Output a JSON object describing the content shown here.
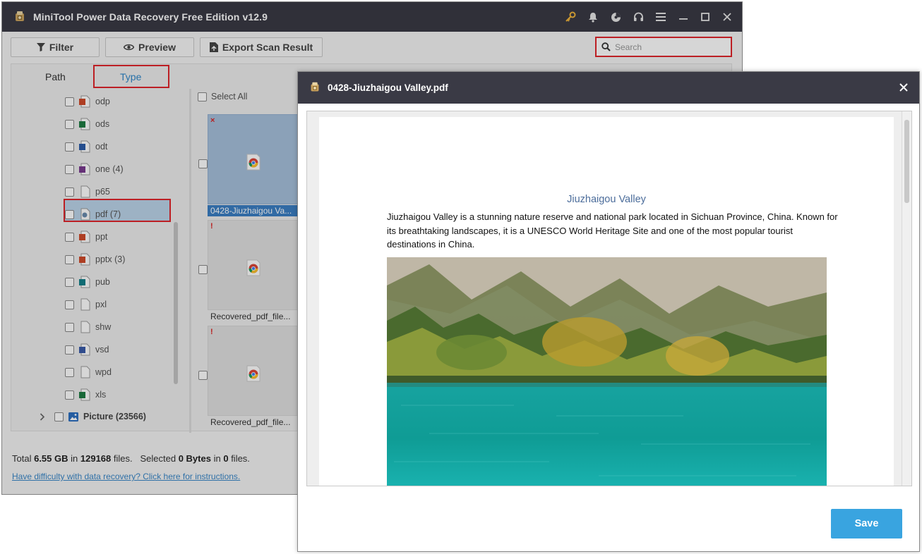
{
  "app": {
    "title": "MiniTool Power Data Recovery Free Edition v12.9",
    "window_icons": [
      "key-icon",
      "bell-icon",
      "disc-icon",
      "headset-icon",
      "menu-icon",
      "minimize-icon",
      "maximize-icon",
      "close-icon"
    ]
  },
  "toolbar": {
    "filter_label": "Filter",
    "preview_label": "Preview",
    "export_label": "Export Scan Result",
    "search_placeholder": "Search"
  },
  "tabs": {
    "path": "Path",
    "type": "Type"
  },
  "tree": {
    "items": [
      {
        "label": "odp",
        "icon": "presentation-icon",
        "color": "#d04a2a"
      },
      {
        "label": "ods",
        "icon": "spreadsheet-icon",
        "color": "#1e7c43"
      },
      {
        "label": "odt",
        "icon": "word-doc-icon",
        "color": "#2b5ca8"
      },
      {
        "label": "one (4)",
        "icon": "onenote-icon",
        "color": "#7a3b8f"
      },
      {
        "label": "p65",
        "icon": "blank-file-icon",
        "color": "#999999"
      },
      {
        "label": "pdf (7)",
        "icon": "pdf-file-icon",
        "color": "#6a8cae"
      },
      {
        "label": "ppt",
        "icon": "presentation-icon",
        "color": "#d04a2a"
      },
      {
        "label": "pptx (3)",
        "icon": "presentation-icon",
        "color": "#d04a2a"
      },
      {
        "label": "pub",
        "icon": "publisher-icon",
        "color": "#13808a"
      },
      {
        "label": "pxl",
        "icon": "blank-file-icon",
        "color": "#999999"
      },
      {
        "label": "shw",
        "icon": "blank-file-icon",
        "color": "#999999"
      },
      {
        "label": "vsd",
        "icon": "visio-icon",
        "color": "#3a5ba8"
      },
      {
        "label": "wpd",
        "icon": "blank-file-icon",
        "color": "#999999"
      },
      {
        "label": "xls",
        "icon": "spreadsheet-icon",
        "color": "#1e7c43"
      }
    ],
    "picture_label": "Picture (23566)"
  },
  "files": {
    "select_all": "Select All",
    "items": [
      {
        "name": "0428-Jiuzhaigou Va...",
        "mark": "×",
        "selected": true
      },
      {
        "name": "Recovered_pdf_file...",
        "mark": "!",
        "selected": false
      },
      {
        "name": "Recovered_pdf_file...",
        "mark": "!",
        "selected": false
      }
    ]
  },
  "status": {
    "total_prefix": "Total",
    "total_size": "6.55 GB",
    "in_word": "in",
    "total_files": "129168",
    "files_word": "files.",
    "selected_prefix": "Selected",
    "selected_size": "0 Bytes",
    "selected_files": "0",
    "help_link": "Have difficulty with data recovery? Click here for instructions."
  },
  "preview": {
    "title": "0428-Jiuzhaigou Valley.pdf",
    "doc_heading": "Jiuzhaigou Valley",
    "doc_text": "Jiuzhaigou Valley is a stunning nature reserve and national park located in Sichuan Province, China. Known for its breathtaking landscapes, it is a UNESCO World Heritage Site and one of the most popular tourist destinations in China.",
    "save_label": "Save"
  },
  "colors": {
    "titlebar": "#3a3a45",
    "accent": "#39a4e0",
    "highlight_red": "#e0262b",
    "tab_active": "#2f86c9"
  }
}
